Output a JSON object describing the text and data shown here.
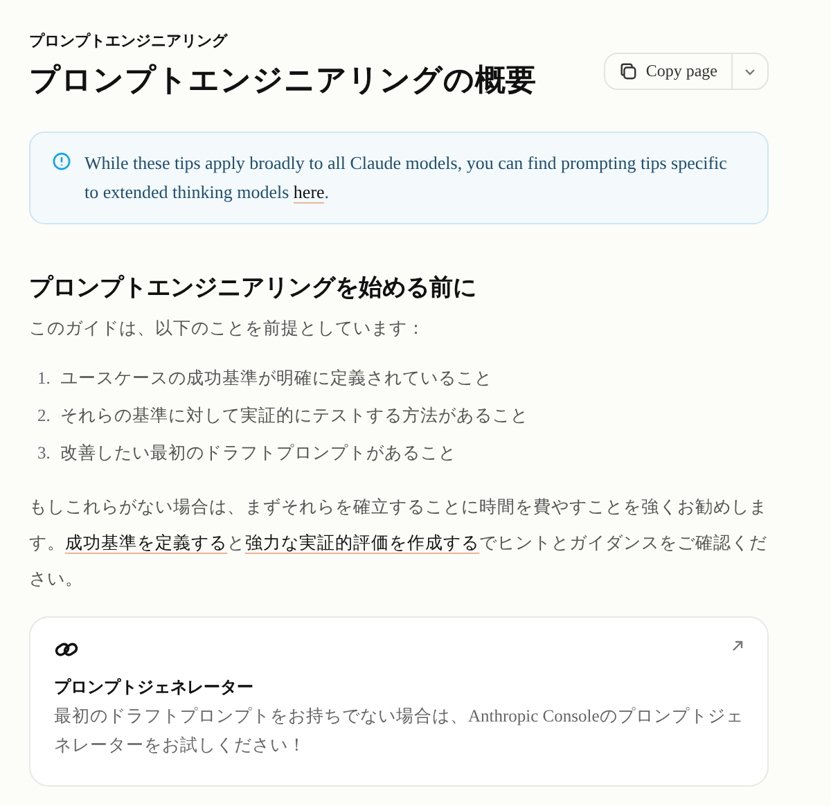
{
  "breadcrumb": "プロンプトエンジニアリング",
  "title": "プロンプトエンジニアリングの概要",
  "copy_button": {
    "label": "Copy page"
  },
  "callout": {
    "text": "While these tips apply broadly to all Claude models, you can find prompting tips specific to extended thinking models ",
    "link": "here",
    "after": "."
  },
  "section": {
    "heading": "プロンプトエンジニアリングを始める前に",
    "intro": "このガイドは、以下のことを前提としています：",
    "list": [
      {
        "number": "1.",
        "text": "ユースケースの成功基準が明確に定義されていること"
      },
      {
        "number": "2.",
        "text": "それらの基準に対して実証的にテストする方法があること"
      },
      {
        "number": "3.",
        "text": "改善したい最初のドラフトプロンプトがあること"
      }
    ],
    "paragraph": [
      {
        "kind": "text",
        "text": "もしこれらがない場合は、まずそれらを確立することに時間を費やすことを強くお勧めします。"
      },
      {
        "kind": "link",
        "text": "成功基準を定義する"
      },
      {
        "kind": "text",
        "text": "と"
      },
      {
        "kind": "link",
        "text": "強力な実証的評価を作成する"
      },
      {
        "kind": "text",
        "text": "でヒントとガイダンスをご確認ください。"
      }
    ]
  },
  "card": {
    "title": "プロンプトジェネレーター",
    "description": "最初のドラフトプロンプトをお持ちでない場合は、Anthropic Consoleのプロンプトジェネレーターをお試しください！"
  }
}
